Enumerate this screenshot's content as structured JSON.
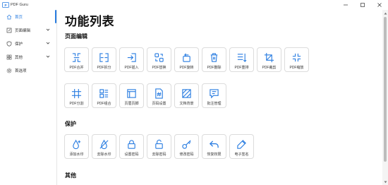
{
  "window": {
    "title": "PDF Guru",
    "controls": [
      "minimize",
      "maximize",
      "close"
    ]
  },
  "sidebar": {
    "items": [
      {
        "label": "首页",
        "icon": "home-icon",
        "active": true
      },
      {
        "label": "页面编辑",
        "icon": "edit-page-icon",
        "expandable": true
      },
      {
        "label": "保护",
        "icon": "shield-icon",
        "expandable": true
      },
      {
        "label": "其他",
        "icon": "grid-icon",
        "expandable": true
      },
      {
        "label": "首选项",
        "icon": "gear-icon"
      }
    ]
  },
  "main": {
    "title": "功能列表",
    "sections": [
      {
        "title": "页面编辑",
        "tools": [
          {
            "label": "PDF合并",
            "icon": "merge-icon"
          },
          {
            "label": "PDF拆分",
            "icon": "split-icon"
          },
          {
            "label": "PDF插入",
            "icon": "insert-icon"
          },
          {
            "label": "PDF替换",
            "icon": "replace-icon"
          },
          {
            "label": "PDF旋转",
            "icon": "rotate-icon"
          },
          {
            "label": "PDF删除",
            "icon": "delete-icon"
          },
          {
            "label": "PDF重排",
            "icon": "reorder-icon"
          },
          {
            "label": "PDF裁剪",
            "icon": "crop-icon"
          },
          {
            "label": "PDF缩放",
            "icon": "scale-icon"
          },
          {
            "label": "PDF分割",
            "icon": "cut-grid-icon"
          },
          {
            "label": "PDF组合",
            "icon": "combine-icon"
          },
          {
            "label": "页眉页脚",
            "icon": "header-footer-icon"
          },
          {
            "label": "页码设置",
            "icon": "page-number-icon"
          },
          {
            "label": "文档背景",
            "icon": "background-icon"
          },
          {
            "label": "批注管理",
            "icon": "annotation-icon"
          }
        ]
      },
      {
        "title": "保护",
        "tools": [
          {
            "label": "添加水印",
            "icon": "add-watermark-icon"
          },
          {
            "label": "去除水印",
            "icon": "remove-watermark-icon"
          },
          {
            "label": "设置密码",
            "icon": "lock-icon"
          },
          {
            "label": "去除密码",
            "icon": "unlock-icon"
          },
          {
            "label": "修改密码",
            "icon": "key-icon"
          },
          {
            "label": "恢复权限",
            "icon": "restore-icon"
          },
          {
            "label": "电子签名",
            "icon": "signature-icon"
          }
        ]
      },
      {
        "title": "其他",
        "tools": []
      }
    ]
  },
  "colors": {
    "accent": "#2a7de1",
    "tile_border": "#dcdcdc",
    "text": "#333333"
  }
}
